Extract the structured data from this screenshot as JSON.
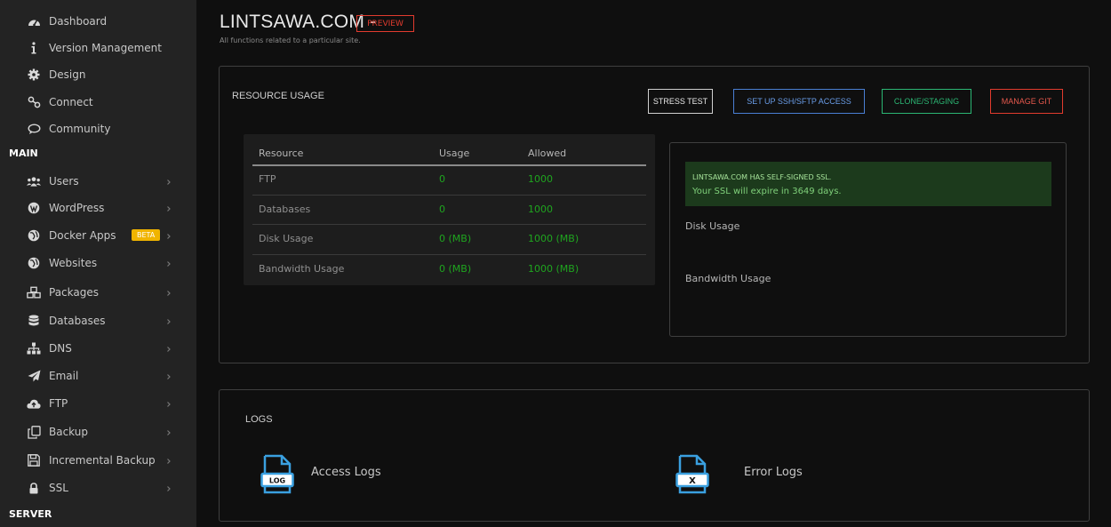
{
  "sidebar": {
    "top_items": [
      {
        "label": "Dashboard",
        "icon": "tachometer-icon"
      },
      {
        "label": "Version Management",
        "icon": "info-icon"
      },
      {
        "label": "Design",
        "icon": "cog-icon"
      },
      {
        "label": "Connect",
        "icon": "link-icon"
      },
      {
        "label": "Community",
        "icon": "chat-icon"
      }
    ],
    "main_section": "MAIN",
    "main_items": [
      {
        "label": "Users",
        "icon": "users-icon"
      },
      {
        "label": "WordPress",
        "icon": "wordpress-icon"
      },
      {
        "label": "Docker Apps",
        "icon": "globe-icon",
        "badge": "BETA"
      },
      {
        "label": "Websites",
        "icon": "globe-icon"
      },
      {
        "label": "Packages",
        "icon": "cubes-icon"
      },
      {
        "label": "Databases",
        "icon": "database-icon"
      },
      {
        "label": "DNS",
        "icon": "sitemap-icon"
      },
      {
        "label": "Email",
        "icon": "paper-plane-icon"
      },
      {
        "label": "FTP",
        "icon": "cloud-upload-icon"
      },
      {
        "label": "Backup",
        "icon": "copy-icon"
      },
      {
        "label": "Incremental Backup",
        "icon": "save-icon"
      },
      {
        "label": "SSL",
        "icon": "lock-icon"
      }
    ],
    "server_section": "SERVER"
  },
  "header": {
    "title": "LINTSAWA.COM -",
    "preview_label": "PREVIEW",
    "subtitle": "All functions related to a particular site."
  },
  "resource_panel": {
    "title": "RESOURCE USAGE",
    "buttons": {
      "stress_test": "STRESS TEST",
      "ssh": "SET UP SSH/SFTP ACCESS",
      "clone": "CLONE/STAGING",
      "git": "MANAGE GIT"
    },
    "table": {
      "headers": [
        "Resource",
        "Usage",
        "Allowed"
      ],
      "rows": [
        {
          "resource": "FTP",
          "usage": "0",
          "allowed": "1000"
        },
        {
          "resource": "Databases",
          "usage": "0",
          "allowed": "1000"
        },
        {
          "resource": "Disk Usage",
          "usage": "0 (MB)",
          "allowed": "1000 (MB)"
        },
        {
          "resource": "Bandwidth Usage",
          "usage": "0 (MB)",
          "allowed": "1000 (MB)"
        }
      ]
    },
    "ssl": {
      "title": "LINTSAWA.COM HAS SELF-SIGNED SSL.",
      "message": "Your SSL will expire in 3649 days."
    },
    "disk_usage_label": "Disk Usage",
    "bandwidth_usage_label": "Bandwidth Usage"
  },
  "logs_panel": {
    "title": "LOGS",
    "access_label": "Access Logs",
    "access_icon_text": "LOG",
    "error_label": "Error Logs",
    "error_icon_text": "X"
  },
  "colors": {
    "accent_red": "#e23b2e",
    "accent_blue": "#4a7fd4",
    "accent_green": "#2bb673",
    "value_green": "#1fa51f",
    "beta": "#f0b400",
    "icon_blue": "#3aa0e0"
  }
}
